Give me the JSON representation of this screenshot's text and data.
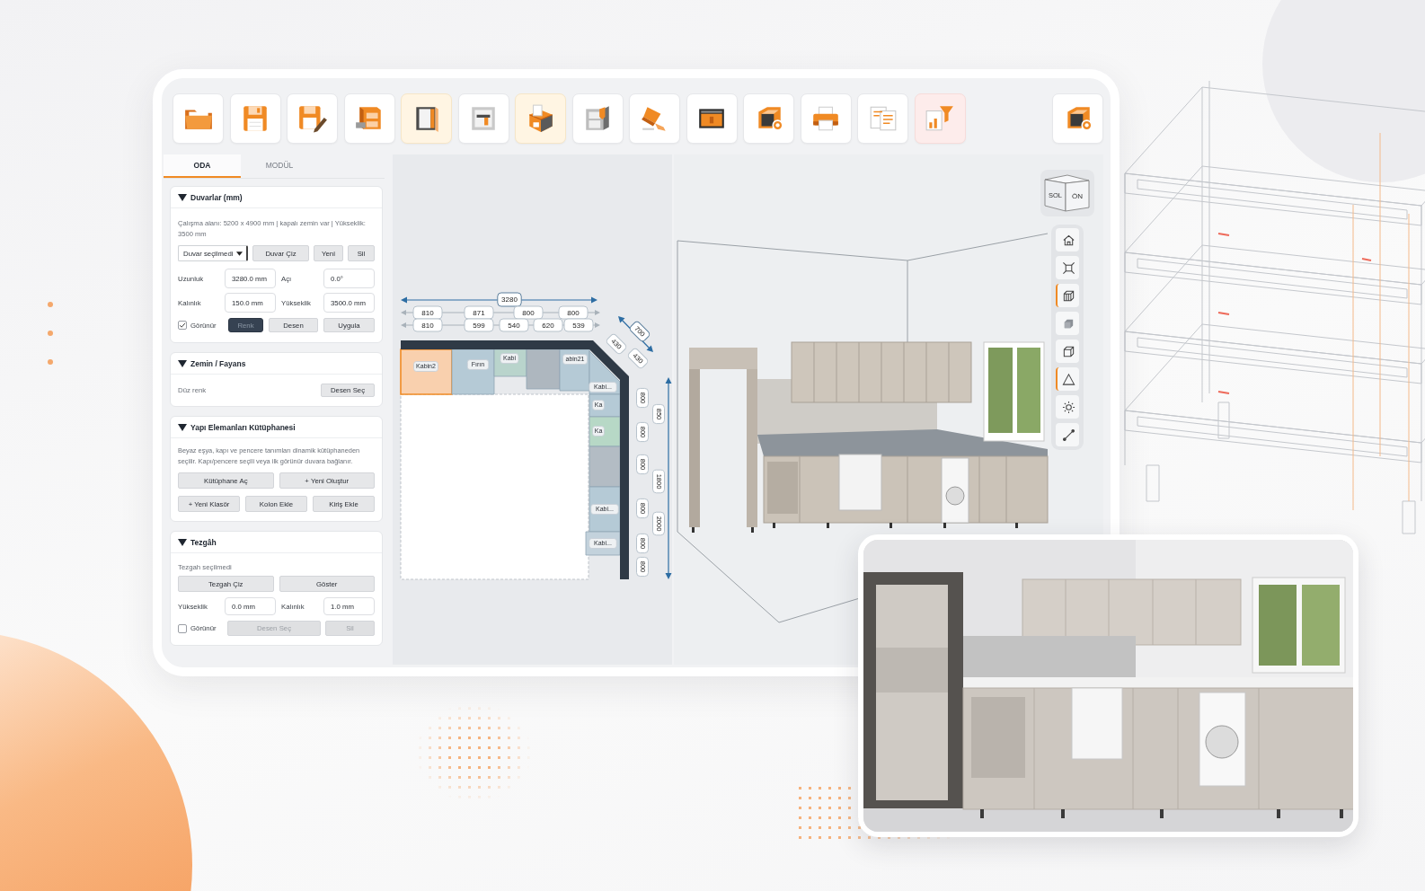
{
  "toolbar": {
    "tools": [
      {
        "kind": "folder",
        "selected": false,
        "alert": false
      },
      {
        "kind": "floppy",
        "selected": false,
        "alert": false
      },
      {
        "kind": "floppy-pen",
        "selected": false,
        "alert": false
      },
      {
        "kind": "cabinet",
        "selected": false,
        "alert": false
      },
      {
        "kind": "wardrobe",
        "selected": true,
        "alert": false
      },
      {
        "kind": "frame",
        "selected": false,
        "alert": false
      },
      {
        "kind": "box-import",
        "selected": true,
        "alert": false
      },
      {
        "kind": "cabinet-door",
        "selected": false,
        "alert": false
      },
      {
        "kind": "brush",
        "selected": false,
        "alert": false
      },
      {
        "kind": "panel",
        "selected": false,
        "alert": false
      },
      {
        "kind": "cube-camera",
        "selected": false,
        "alert": false
      },
      {
        "kind": "printer",
        "selected": false,
        "alert": false
      },
      {
        "kind": "document",
        "selected": false,
        "alert": false
      },
      {
        "kind": "filter-chart",
        "selected": false,
        "alert": true
      }
    ],
    "end_tools": [
      {
        "kind": "cube-camera",
        "selected": false,
        "alert": false
      }
    ]
  },
  "side_panel": {
    "tabs": [
      {
        "label": "ODA",
        "selected": true
      },
      {
        "label": "MODÜL",
        "selected": false
      }
    ],
    "sections": [
      {
        "kind": "walls",
        "title": "Duvarlar (mm)",
        "expanded": true,
        "info": "Çalışma alanı: 5200 x 4900 mm | kapalı zemin var | Yükseklik: 3500 mm",
        "wall_select": {
          "value": "Duvar seçilmedi"
        },
        "actions": [
          "Duvar Çiz",
          "Yeni",
          "Sil"
        ],
        "fields": [
          {
            "label": "Uzunluk",
            "value": "3280.0 mm"
          },
          {
            "label": "Açı",
            "value": "0.0°"
          },
          {
            "label": "Kalınlık",
            "value": "150.0 mm"
          },
          {
            "label": "Yükseklik",
            "value": "3500.0 mm"
          }
        ],
        "visible": {
          "label": "Görünür",
          "checked": true
        },
        "color_button": "Renk",
        "buttons": [
          "Desen",
          "Uygula"
        ]
      },
      {
        "kind": "floor",
        "title": "Zemin / Fayans",
        "expanded": true,
        "fill": "Düz renk",
        "button": "Desen Seç"
      },
      {
        "kind": "library",
        "title": "Yapı Elemanları Kütüphanesi",
        "expanded": true,
        "description": "Beyaz eşya, kapı ve pencere tanımları dinamik kütüphaneden seçilir. Kapı/pencere seçili veya ilk görünür duvara bağlanır.",
        "button_rows": [
          [
            "Kütüphane Aç",
            "+ Yeni Oluştur"
          ],
          [
            "+ Yeni Klasör",
            "Kolon Ekle",
            "Kiriş Ekle"
          ]
        ]
      },
      {
        "kind": "counter",
        "title": "Tezgâh",
        "expanded": true,
        "status": "Tezgah seçilmedi",
        "actions": [
          "Tezgah Çiz",
          "Göster"
        ],
        "fields": [
          {
            "label": "Yükseklik",
            "value": "0.0 mm"
          },
          {
            "label": "Kalınlık",
            "value": "1.0 mm"
          }
        ],
        "visible": {
          "label": "Görünür",
          "checked": false
        },
        "buttons": [
          {
            "label": "Desen Seç",
            "disabled": true
          },
          {
            "label": "Sil",
            "disabled": true
          }
        ]
      }
    ]
  },
  "floor_plan": {
    "overall": "3280",
    "upper_row": [
      "810",
      "871",
      "800",
      "800"
    ],
    "lower_row": [
      "810",
      "599",
      "540",
      "620",
      "539"
    ],
    "diagonal": [
      "700",
      "430",
      "430"
    ],
    "vertical": [
      "800",
      "850",
      "800",
      "800",
      "1800",
      "800",
      "2000",
      "800",
      "800"
    ],
    "cabinets": [
      {
        "label": "Kabin2",
        "selected": true,
        "color": "#f9d0ae"
      },
      {
        "label": "Fırın",
        "selected": false,
        "color": "#b5cad6"
      },
      {
        "label": "Kabi",
        "selected": false,
        "color": "#b9d4cc"
      },
      {
        "selected": false,
        "color": "#aeb7bf"
      },
      {
        "label": "abin21",
        "selected": false,
        "color": "#b5cad6"
      },
      {
        "label": "Kabi...",
        "selected": false,
        "color": "#b5cad6"
      },
      {
        "label": "Ka",
        "selected": false,
        "color": "#b5cad6"
      },
      {
        "label": "Ka",
        "selected": false,
        "color": "#b7d8c6"
      },
      {
        "selected": false,
        "color": "#b3bcc4"
      },
      {
        "label": "Kabi...",
        "selected": false,
        "color": "#b5cad6"
      },
      {
        "label": "Kabi...",
        "selected": false,
        "color": "#c3d2dc"
      }
    ]
  },
  "viewport": {
    "view_cube": {
      "faces": [
        "SOL",
        "ÖN"
      ]
    },
    "view_tools": [
      {
        "kind": "home",
        "selected": false
      },
      {
        "kind": "fit",
        "selected": false
      },
      {
        "kind": "wire-cube",
        "selected": true
      },
      {
        "kind": "solid-cube",
        "selected": false
      },
      {
        "kind": "outline-cube",
        "selected": false
      },
      {
        "kind": "perspective",
        "selected": true
      },
      {
        "kind": "sun",
        "selected": false
      },
      {
        "kind": "measure",
        "selected": false
      }
    ]
  }
}
